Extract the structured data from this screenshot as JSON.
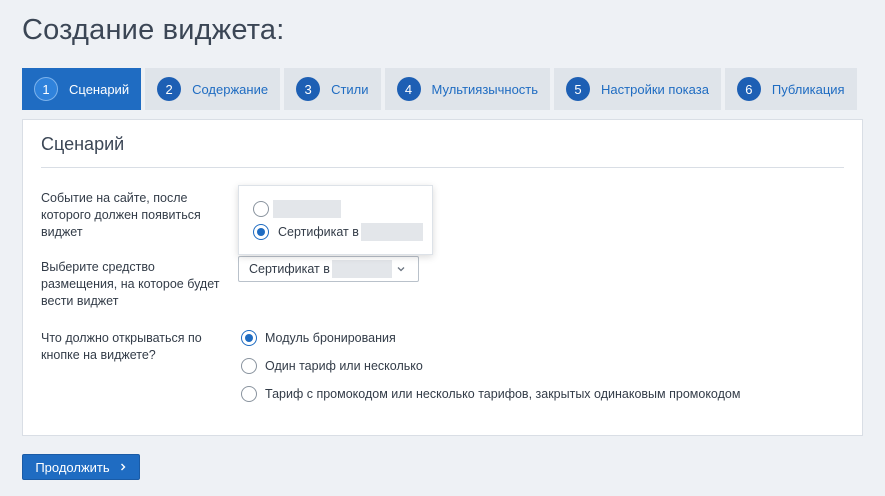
{
  "page": {
    "title": "Создание виджета:"
  },
  "tabs": [
    {
      "num": "1",
      "label": "Сценарий",
      "active": true
    },
    {
      "num": "2",
      "label": "Содержание",
      "active": false
    },
    {
      "num": "3",
      "label": "Стили",
      "active": false
    },
    {
      "num": "4",
      "label": "Мультиязычность",
      "active": false
    },
    {
      "num": "5",
      "label": "Настройки показа",
      "active": false
    },
    {
      "num": "6",
      "label": "Публикация",
      "active": false
    }
  ],
  "card": {
    "title": "Сценарий"
  },
  "fields": {
    "event": {
      "label": "Событие на сайте, после которого должен появиться виджет",
      "dropdown_options": [
        {
          "label": "",
          "checked": false
        },
        {
          "label": "Сертификат в",
          "checked": true
        }
      ]
    },
    "placement": {
      "label": "Выберите средство размещения, на которое будет вести виджет",
      "selected_value": "Сертификат в"
    },
    "button_action": {
      "label": "Что должно открываться по кнопке на виджете?",
      "options": [
        {
          "label": "Модуль бронирования",
          "checked": true
        },
        {
          "label": "Один тариф или несколько",
          "checked": false
        },
        {
          "label": "Тариф с промокодом или несколько тарифов, закрытых одинаковым промокодом",
          "checked": false
        }
      ]
    }
  },
  "footer": {
    "continue_label": "Продолжить"
  },
  "icons": {
    "select_chevron": "chevron-down-icon",
    "continue_chevron": "chevron-right-icon"
  },
  "colors": {
    "accent": "#1f6cc2",
    "tab_bg": "#dfe4ea",
    "page_bg": "#eef1f5"
  }
}
